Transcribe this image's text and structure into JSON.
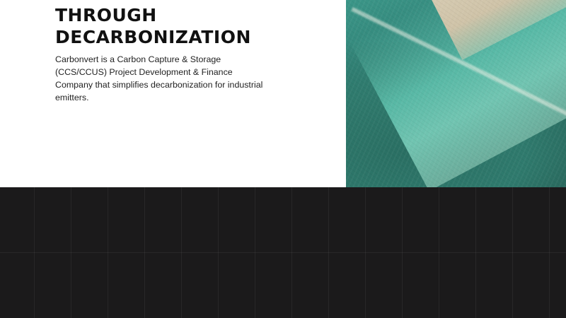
{
  "hero": {
    "title_lines": [
      "THROUGH",
      "DECARBONIZATION"
    ],
    "description_lines": [
      "Carbonvert is a Carbon Capture & Storage",
      "(CCS/CCUS) Project Development & Finance",
      "Company that simplifies decarbonization for industrial",
      "emitters."
    ]
  },
  "colors": {
    "hero_background": "#ffffff",
    "dark_background": "#1b1a1b",
    "title_text": "#111111",
    "body_text": "#222222"
  },
  "icons": {
    "photo": "aerial-beach-photo"
  }
}
